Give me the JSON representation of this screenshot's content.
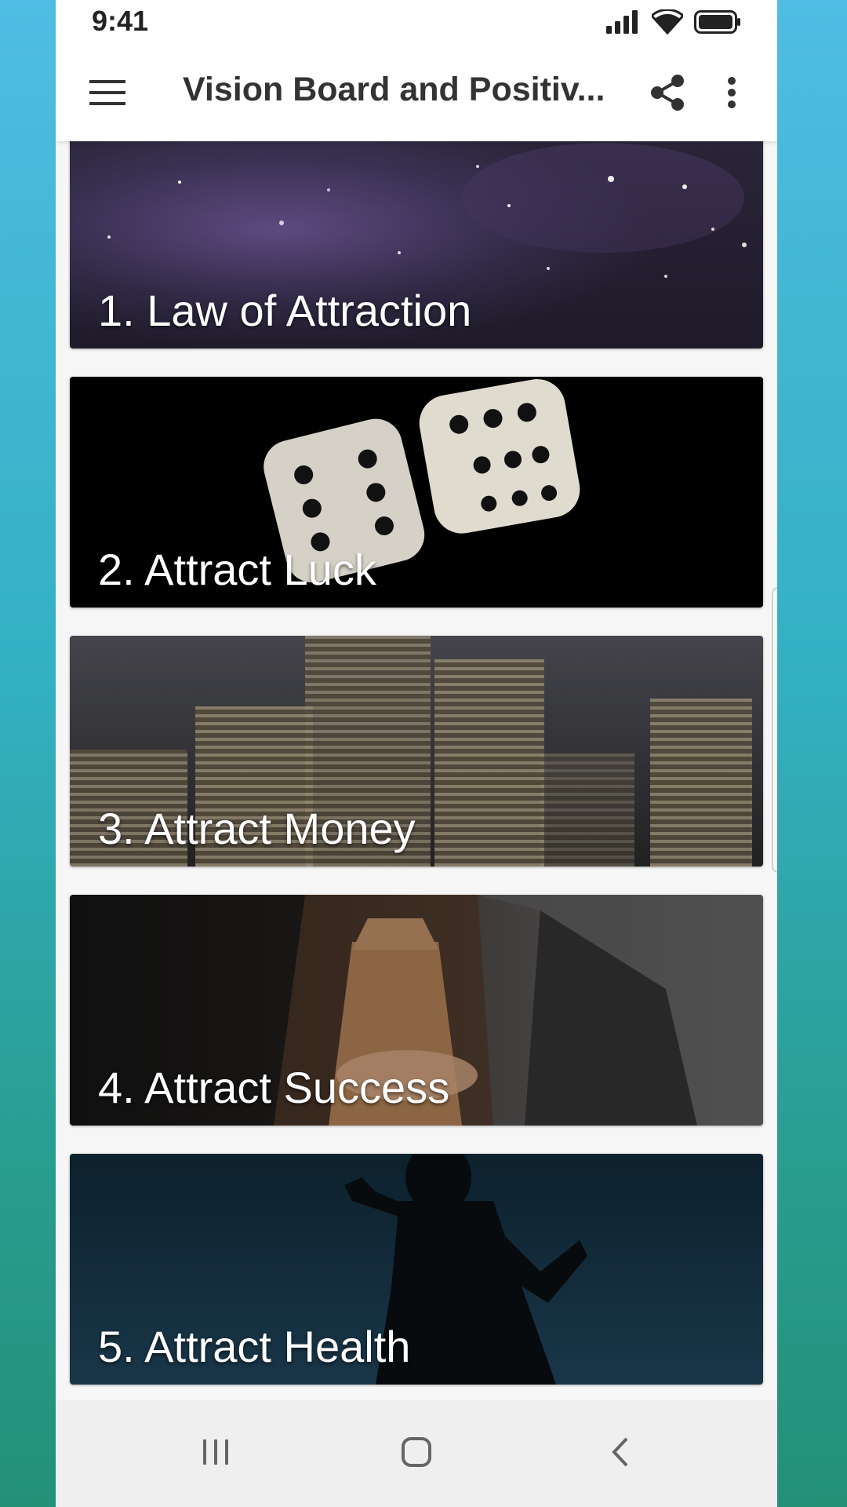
{
  "status_bar": {
    "time": "9:41",
    "icons": [
      "signal-icon",
      "wifi-icon",
      "battery-icon"
    ]
  },
  "app_bar": {
    "title": "Vision Board and Positiv...",
    "menu_icon": "hamburger-menu-icon",
    "share_icon": "share-icon",
    "more_icon": "more-vert-icon"
  },
  "cards": [
    {
      "label": "1. Law of Attraction",
      "image": "galaxy-stars-image"
    },
    {
      "label": "2. Attract Luck",
      "image": "dice-image"
    },
    {
      "label": "3. Attract Money",
      "image": "coin-stacks-image"
    },
    {
      "label": "4. Attract Success",
      "image": "suit-tie-image"
    },
    {
      "label": "5. Attract Health",
      "image": "runner-silhouette-image"
    }
  ],
  "nav_bar": {
    "recents_icon": "recents-icon",
    "home_icon": "home-icon",
    "back_icon": "back-icon"
  },
  "colors": {
    "background_top": "#4fbde3",
    "background_bottom": "#239178",
    "app_bar": "#ffffff",
    "title_text": "#333333",
    "card_text": "#ffffff"
  }
}
